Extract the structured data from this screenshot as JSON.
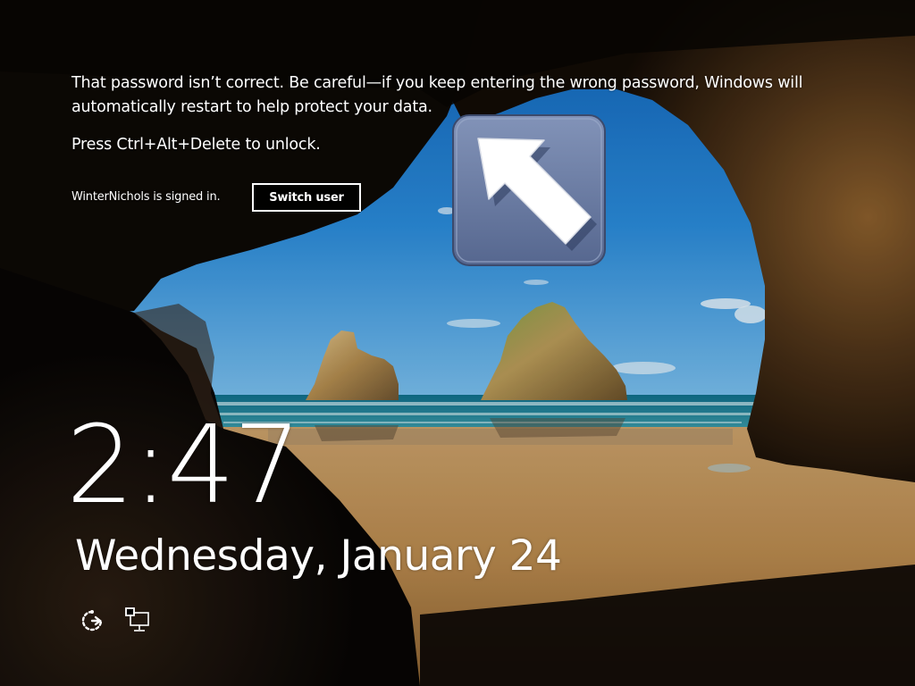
{
  "lock_screen": {
    "warning_message": "That password isn’t correct. Be careful—if you keep entering the wrong password, Windows will automatically restart to help protect your data.",
    "unlock_hint": "Press Ctrl+Alt+Delete to unlock.",
    "signed_in_text": "WinterNichols is signed in.",
    "switch_user_label": "Switch user",
    "time": "2:47",
    "date": "Wednesday, January 24"
  },
  "icons": {
    "arrow_badge": "up-left-arrow-icon",
    "ease_of_access": "ease-of-access-icon",
    "network": "network-icon"
  },
  "colors": {
    "text": "#ffffff",
    "badge_fill": "#6d7fa6",
    "sky": "#1f7fd0",
    "sand": "#b98a4f"
  }
}
